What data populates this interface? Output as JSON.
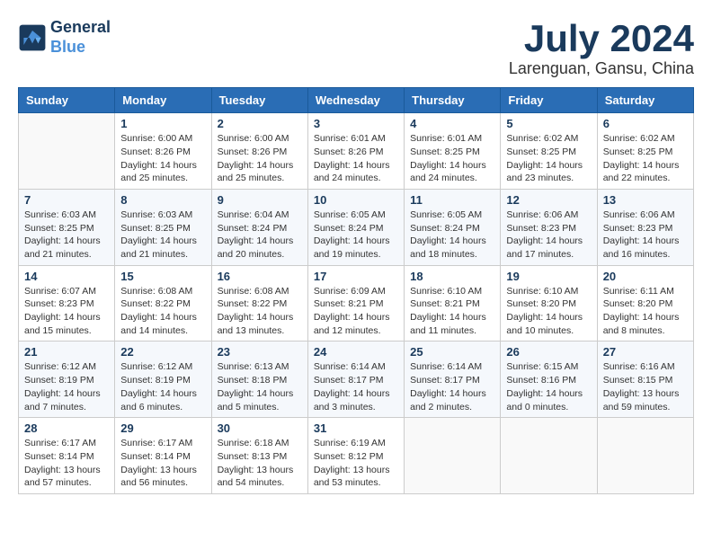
{
  "header": {
    "logo_line1": "General",
    "logo_line2": "Blue",
    "title": "July 2024",
    "subtitle": "Larenguan, Gansu, China"
  },
  "days_of_week": [
    "Sunday",
    "Monday",
    "Tuesday",
    "Wednesday",
    "Thursday",
    "Friday",
    "Saturday"
  ],
  "weeks": [
    [
      {
        "num": "",
        "info": ""
      },
      {
        "num": "1",
        "info": "Sunrise: 6:00 AM\nSunset: 8:26 PM\nDaylight: 14 hours\nand 25 minutes."
      },
      {
        "num": "2",
        "info": "Sunrise: 6:00 AM\nSunset: 8:26 PM\nDaylight: 14 hours\nand 25 minutes."
      },
      {
        "num": "3",
        "info": "Sunrise: 6:01 AM\nSunset: 8:26 PM\nDaylight: 14 hours\nand 24 minutes."
      },
      {
        "num": "4",
        "info": "Sunrise: 6:01 AM\nSunset: 8:25 PM\nDaylight: 14 hours\nand 24 minutes."
      },
      {
        "num": "5",
        "info": "Sunrise: 6:02 AM\nSunset: 8:25 PM\nDaylight: 14 hours\nand 23 minutes."
      },
      {
        "num": "6",
        "info": "Sunrise: 6:02 AM\nSunset: 8:25 PM\nDaylight: 14 hours\nand 22 minutes."
      }
    ],
    [
      {
        "num": "7",
        "info": "Sunrise: 6:03 AM\nSunset: 8:25 PM\nDaylight: 14 hours\nand 21 minutes."
      },
      {
        "num": "8",
        "info": "Sunrise: 6:03 AM\nSunset: 8:25 PM\nDaylight: 14 hours\nand 21 minutes."
      },
      {
        "num": "9",
        "info": "Sunrise: 6:04 AM\nSunset: 8:24 PM\nDaylight: 14 hours\nand 20 minutes."
      },
      {
        "num": "10",
        "info": "Sunrise: 6:05 AM\nSunset: 8:24 PM\nDaylight: 14 hours\nand 19 minutes."
      },
      {
        "num": "11",
        "info": "Sunrise: 6:05 AM\nSunset: 8:24 PM\nDaylight: 14 hours\nand 18 minutes."
      },
      {
        "num": "12",
        "info": "Sunrise: 6:06 AM\nSunset: 8:23 PM\nDaylight: 14 hours\nand 17 minutes."
      },
      {
        "num": "13",
        "info": "Sunrise: 6:06 AM\nSunset: 8:23 PM\nDaylight: 14 hours\nand 16 minutes."
      }
    ],
    [
      {
        "num": "14",
        "info": "Sunrise: 6:07 AM\nSunset: 8:23 PM\nDaylight: 14 hours\nand 15 minutes."
      },
      {
        "num": "15",
        "info": "Sunrise: 6:08 AM\nSunset: 8:22 PM\nDaylight: 14 hours\nand 14 minutes."
      },
      {
        "num": "16",
        "info": "Sunrise: 6:08 AM\nSunset: 8:22 PM\nDaylight: 14 hours\nand 13 minutes."
      },
      {
        "num": "17",
        "info": "Sunrise: 6:09 AM\nSunset: 8:21 PM\nDaylight: 14 hours\nand 12 minutes."
      },
      {
        "num": "18",
        "info": "Sunrise: 6:10 AM\nSunset: 8:21 PM\nDaylight: 14 hours\nand 11 minutes."
      },
      {
        "num": "19",
        "info": "Sunrise: 6:10 AM\nSunset: 8:20 PM\nDaylight: 14 hours\nand 10 minutes."
      },
      {
        "num": "20",
        "info": "Sunrise: 6:11 AM\nSunset: 8:20 PM\nDaylight: 14 hours\nand 8 minutes."
      }
    ],
    [
      {
        "num": "21",
        "info": "Sunrise: 6:12 AM\nSunset: 8:19 PM\nDaylight: 14 hours\nand 7 minutes."
      },
      {
        "num": "22",
        "info": "Sunrise: 6:12 AM\nSunset: 8:19 PM\nDaylight: 14 hours\nand 6 minutes."
      },
      {
        "num": "23",
        "info": "Sunrise: 6:13 AM\nSunset: 8:18 PM\nDaylight: 14 hours\nand 5 minutes."
      },
      {
        "num": "24",
        "info": "Sunrise: 6:14 AM\nSunset: 8:17 PM\nDaylight: 14 hours\nand 3 minutes."
      },
      {
        "num": "25",
        "info": "Sunrise: 6:14 AM\nSunset: 8:17 PM\nDaylight: 14 hours\nand 2 minutes."
      },
      {
        "num": "26",
        "info": "Sunrise: 6:15 AM\nSunset: 8:16 PM\nDaylight: 14 hours\nand 0 minutes."
      },
      {
        "num": "27",
        "info": "Sunrise: 6:16 AM\nSunset: 8:15 PM\nDaylight: 13 hours\nand 59 minutes."
      }
    ],
    [
      {
        "num": "28",
        "info": "Sunrise: 6:17 AM\nSunset: 8:14 PM\nDaylight: 13 hours\nand 57 minutes."
      },
      {
        "num": "29",
        "info": "Sunrise: 6:17 AM\nSunset: 8:14 PM\nDaylight: 13 hours\nand 56 minutes."
      },
      {
        "num": "30",
        "info": "Sunrise: 6:18 AM\nSunset: 8:13 PM\nDaylight: 13 hours\nand 54 minutes."
      },
      {
        "num": "31",
        "info": "Sunrise: 6:19 AM\nSunset: 8:12 PM\nDaylight: 13 hours\nand 53 minutes."
      },
      {
        "num": "",
        "info": ""
      },
      {
        "num": "",
        "info": ""
      },
      {
        "num": "",
        "info": ""
      }
    ]
  ]
}
